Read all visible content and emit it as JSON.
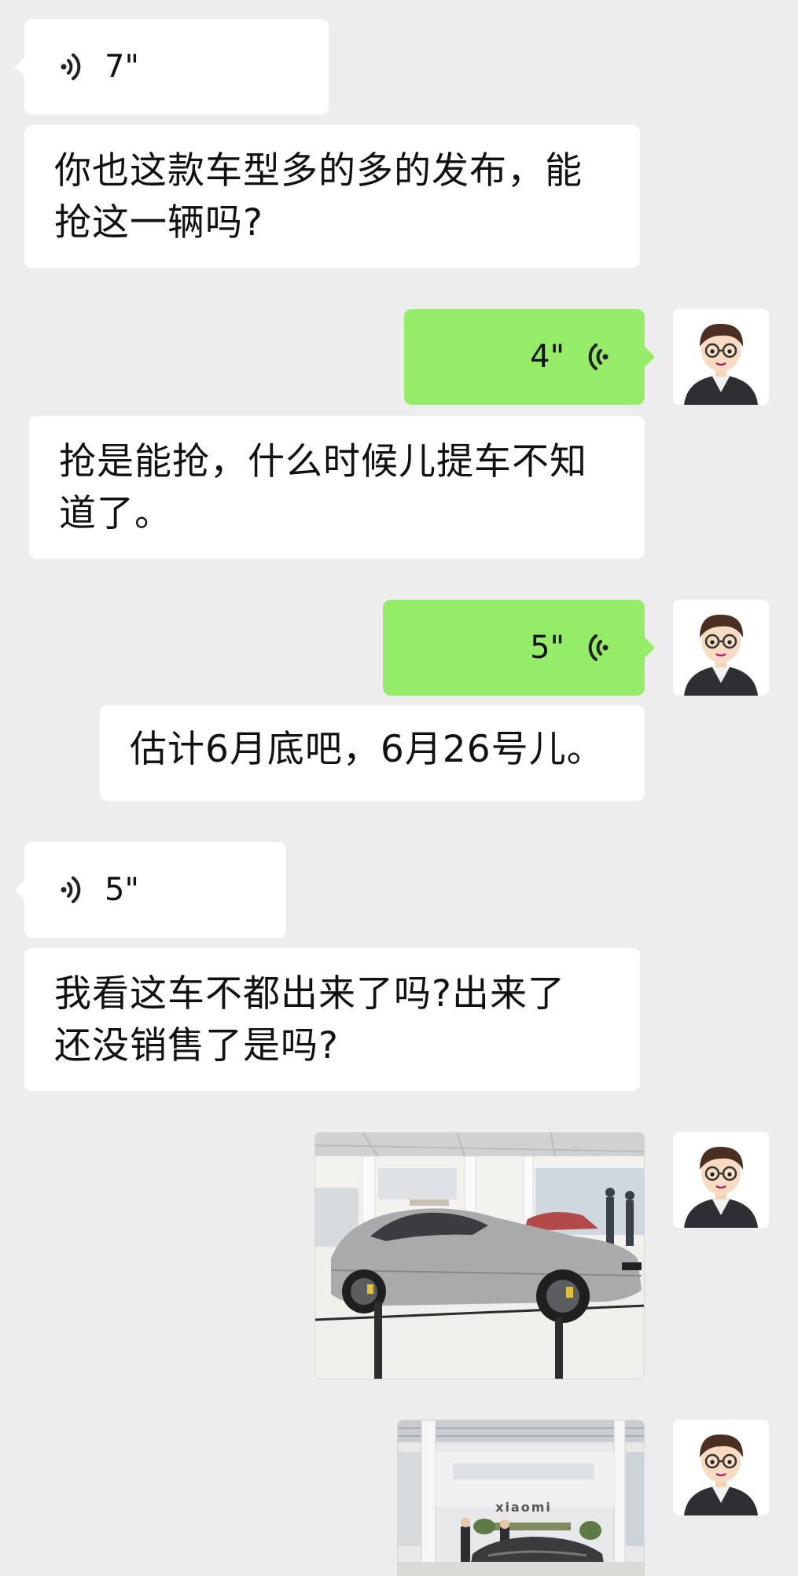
{
  "messages": [
    {
      "type": "voice",
      "side": "left",
      "duration": "7\""
    },
    {
      "type": "text",
      "side": "left",
      "lines": [
        "你也这款车型多的多的发布，能",
        "抢这一辆吗?"
      ]
    },
    {
      "type": "voice",
      "side": "right",
      "duration": "4\""
    },
    {
      "type": "text",
      "side": "right",
      "lines": [
        "抢是能抢，什么时候儿提车不知",
        "道了。"
      ]
    },
    {
      "type": "voice",
      "side": "right",
      "duration": "5\""
    },
    {
      "type": "text",
      "side": "right",
      "lines": [
        "估计6月底吧，6月26号儿。"
      ]
    },
    {
      "type": "voice",
      "side": "left",
      "duration": "5\""
    },
    {
      "type": "text",
      "side": "left",
      "lines": [
        "我看这车不都出来了吗?出来了",
        "还没销售了是吗?"
      ]
    },
    {
      "type": "image",
      "side": "right",
      "icon": "car-showroom-photo"
    },
    {
      "type": "image",
      "side": "right",
      "icon": "xiaomi-store-photo",
      "sign_text": "xiaomi"
    }
  ],
  "colors": {
    "background": "#ededed",
    "incoming_bubble": "#ffffff",
    "outgoing_bubble": "#95ec69"
  },
  "icons": {
    "voice_in": "voice-wave-icon",
    "voice_out": "voice-wave-icon",
    "avatar": "cartoon-man-avatar"
  }
}
